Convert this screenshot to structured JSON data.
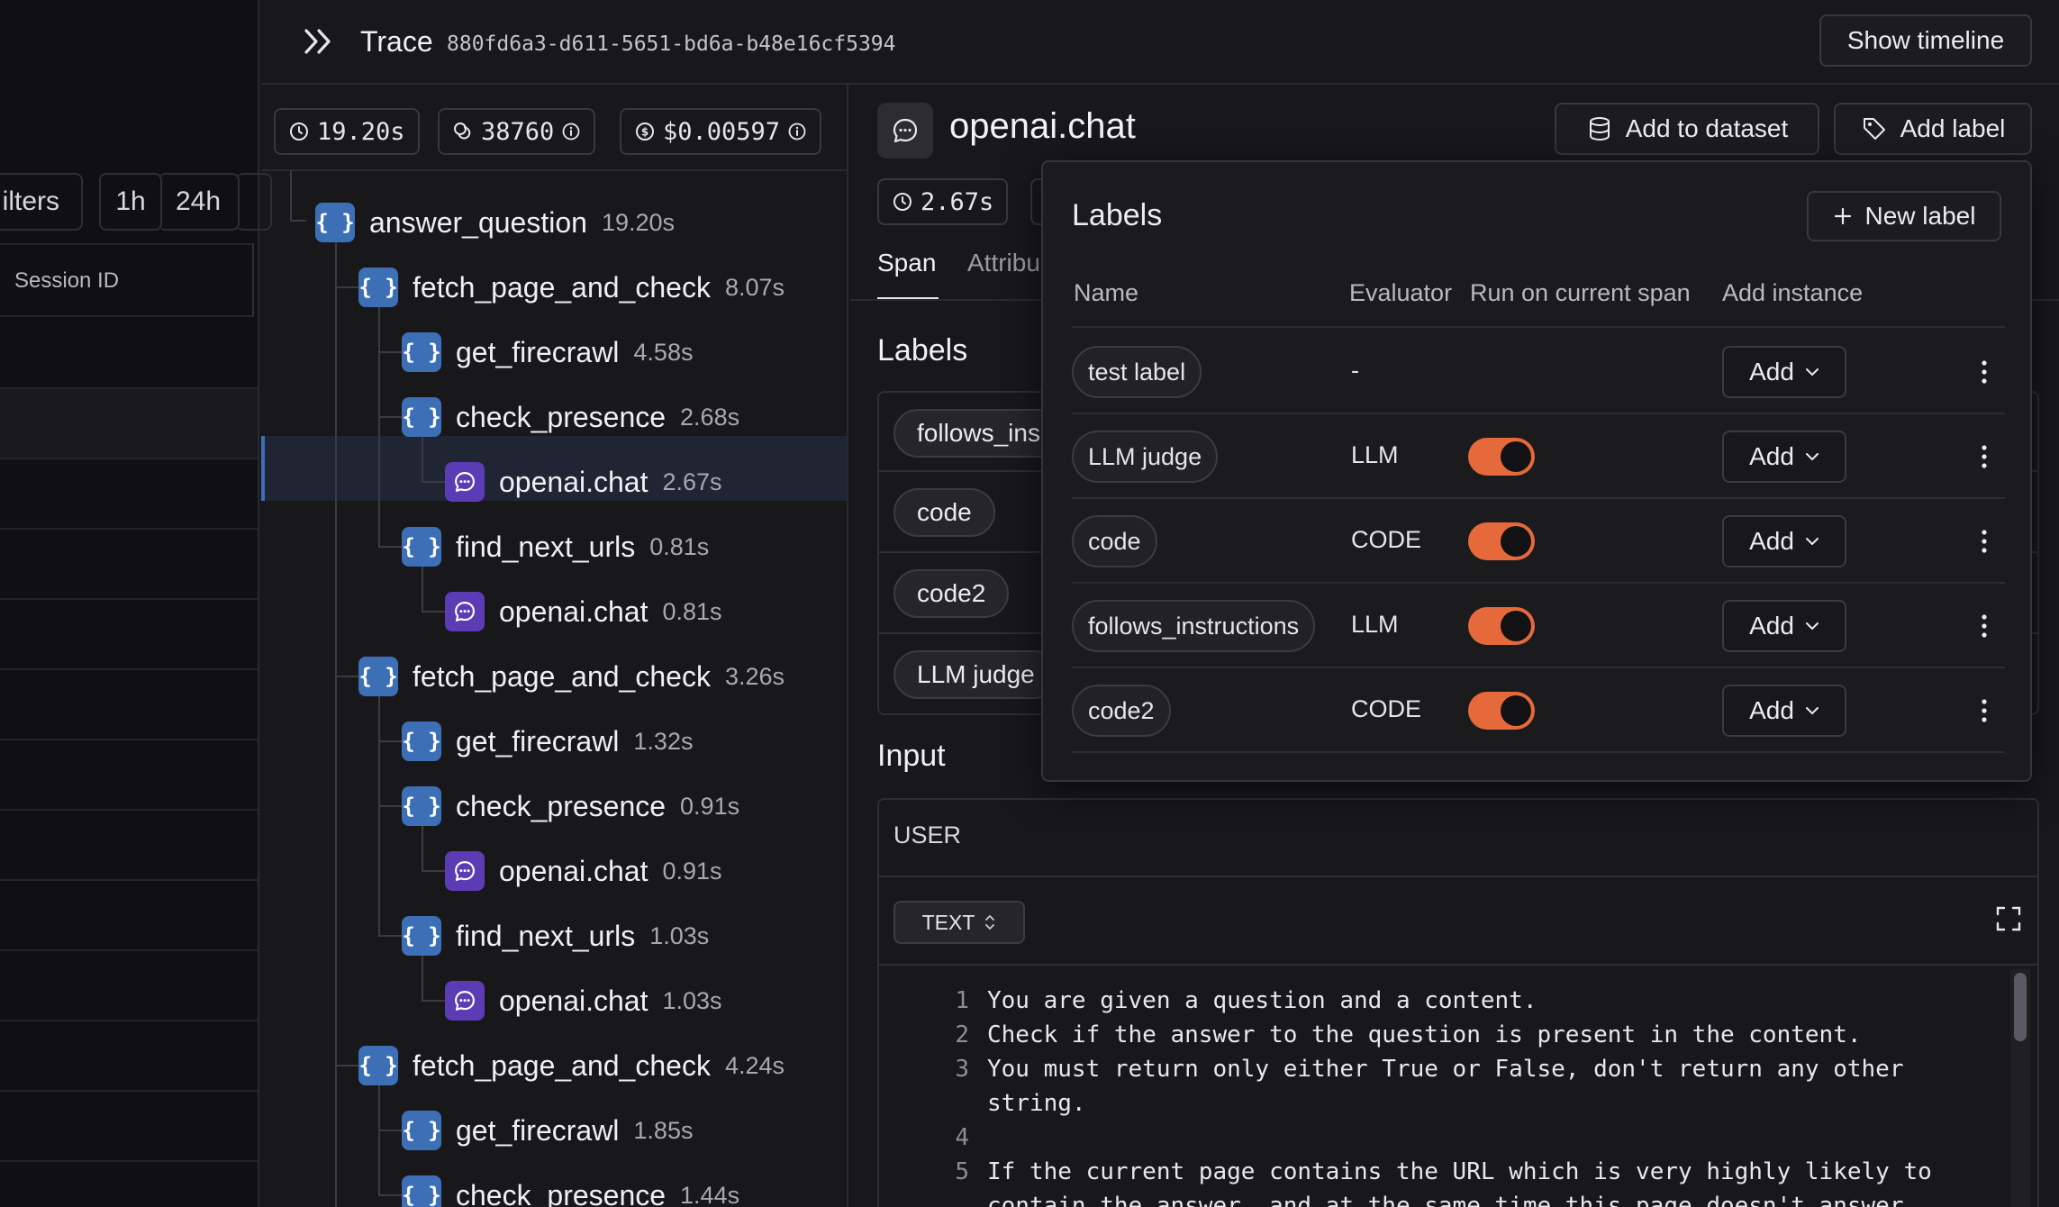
{
  "left_panel": {
    "filters_label": "ilters",
    "time_ranges": [
      "1h",
      "24h"
    ],
    "column_header": "Session ID"
  },
  "header": {
    "title": "Trace",
    "trace_id": "880fd6a3-d611-5651-bd6a-b48e16cf5394",
    "show_timeline": "Show timeline"
  },
  "stats": {
    "duration": "19.20s",
    "tokens": "38760",
    "cost": "$0.00597"
  },
  "tree": [
    {
      "name": "answer_question",
      "duration": "19.20s",
      "kind": "function"
    },
    {
      "name": "fetch_page_and_check",
      "duration": "8.07s",
      "kind": "function"
    },
    {
      "name": "get_firecrawl",
      "duration": "4.58s",
      "kind": "function"
    },
    {
      "name": "check_presence",
      "duration": "2.68s",
      "kind": "function"
    },
    {
      "name": "openai.chat",
      "duration": "2.67s",
      "kind": "llm",
      "selected": true
    },
    {
      "name": "find_next_urls",
      "duration": "0.81s",
      "kind": "function"
    },
    {
      "name": "openai.chat",
      "duration": "0.81s",
      "kind": "llm"
    },
    {
      "name": "fetch_page_and_check",
      "duration": "3.26s",
      "kind": "function"
    },
    {
      "name": "get_firecrawl",
      "duration": "1.32s",
      "kind": "function"
    },
    {
      "name": "check_presence",
      "duration": "0.91s",
      "kind": "function"
    },
    {
      "name": "openai.chat",
      "duration": "0.91s",
      "kind": "llm"
    },
    {
      "name": "find_next_urls",
      "duration": "1.03s",
      "kind": "function"
    },
    {
      "name": "openai.chat",
      "duration": "1.03s",
      "kind": "llm"
    },
    {
      "name": "fetch_page_and_check",
      "duration": "4.24s",
      "kind": "function"
    },
    {
      "name": "get_firecrawl",
      "duration": "1.85s",
      "kind": "function"
    },
    {
      "name": "check_presence",
      "duration": "1.44s",
      "kind": "function"
    }
  ],
  "span": {
    "title": "openai.chat",
    "duration": "2.67s",
    "add_to_dataset": "Add to dataset",
    "add_label": "Add label",
    "tabs": [
      "Span",
      "Attribu"
    ],
    "labels_heading": "Labels",
    "applied_labels": [
      "follows_ins",
      "code",
      "code2",
      "LLM judge"
    ],
    "input_heading": "Input",
    "role": "USER",
    "format": "TEXT",
    "code_lines": [
      {
        "n": "1",
        "text": "You are given a question and a content."
      },
      {
        "n": "2",
        "text": "Check if the answer to the question is present in the content."
      },
      {
        "n": "3",
        "text": "You must return only either True or False, don't return any other"
      },
      {
        "n": "",
        "text": "string."
      },
      {
        "n": "4",
        "text": ""
      },
      {
        "n": "5",
        "text": "If the current page contains the URL which is very highly likely to"
      },
      {
        "n": "",
        "text": "contain the answer, and at the same time this page doesn't answer"
      }
    ]
  },
  "labels_popover": {
    "title": "Labels",
    "new_label": "New label",
    "columns": [
      "Name",
      "Evaluator",
      "Run on current span",
      "Add instance"
    ],
    "rows": [
      {
        "name": "test label",
        "evaluator": "-",
        "run": false,
        "add": "Add"
      },
      {
        "name": "LLM judge",
        "evaluator": "LLM",
        "run": true,
        "add": "Add"
      },
      {
        "name": "code",
        "evaluator": "CODE",
        "run": true,
        "add": "Add"
      },
      {
        "name": "follows_instructions",
        "evaluator": "LLM",
        "run": true,
        "add": "Add"
      },
      {
        "name": "code2",
        "evaluator": "CODE",
        "run": true,
        "add": "Add"
      }
    ]
  },
  "colors": {
    "function_icon": "#3d6fb6",
    "llm_icon": "#5b3cb4",
    "toggle_on": "#e5693a",
    "selected_row": "#1f2533"
  }
}
